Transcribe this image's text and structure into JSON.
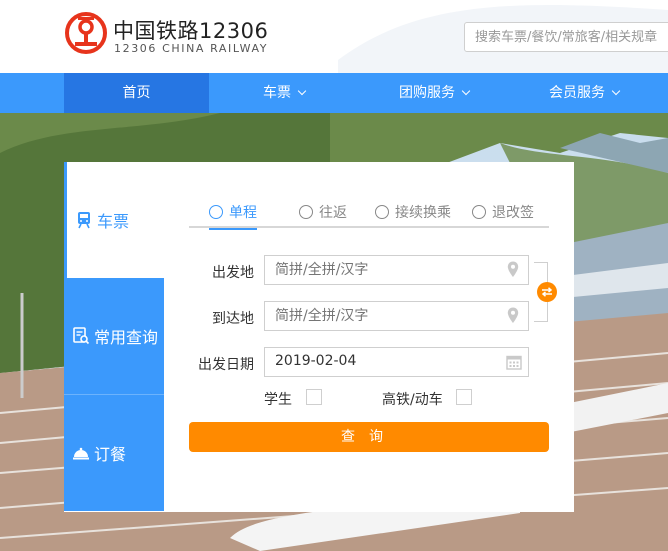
{
  "brand": {
    "name_cn": "中国铁路12306",
    "name_en": "12306 CHINA RAILWAY",
    "logo": "china-railway-logo"
  },
  "search": {
    "placeholder": "搜索车票/餐饮/常旅客/相关规章"
  },
  "nav": {
    "items": [
      {
        "label": "首页",
        "active": true
      },
      {
        "label": "车票",
        "dropdown": true
      },
      {
        "label": "团购服务",
        "dropdown": true
      },
      {
        "label": "会员服务",
        "dropdown": true
      }
    ]
  },
  "side_tabs": [
    {
      "label": "车票",
      "icon": "train-icon",
      "active": true
    },
    {
      "label": "常用查询",
      "icon": "query-doc-icon"
    },
    {
      "label": "订餐",
      "icon": "cloche-icon"
    }
  ],
  "trip_tabs": [
    {
      "label": "单程",
      "active": true
    },
    {
      "label": "往返"
    },
    {
      "label": "接续换乘"
    },
    {
      "label": "退改签"
    }
  ],
  "form": {
    "from_label": "出发地",
    "from_placeholder": "简拼/全拼/汉字",
    "to_label": "到达地",
    "to_placeholder": "简拼/全拼/汉字",
    "date_label": "出发日期",
    "date_value": "2019-02-04",
    "student_label": "学生",
    "student_checked": false,
    "highspeed_label": "高铁/动车",
    "highspeed_checked": false,
    "query_label": "查询"
  },
  "colors": {
    "nav_blue": "#3b99fc",
    "nav_active": "#2676e3",
    "accent_orange": "#ff8a00",
    "logo_red": "#e7341c"
  }
}
